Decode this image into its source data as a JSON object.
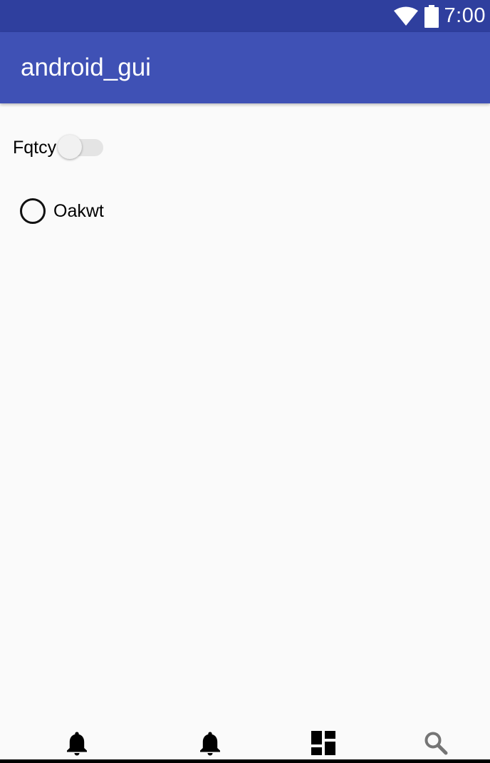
{
  "status_bar": {
    "time": "7:00",
    "icons": [
      "wifi-icon",
      "battery-icon"
    ],
    "background_color": "#2f3f9e"
  },
  "app_bar": {
    "title": "android_gui",
    "background_color": "#3f51b5"
  },
  "content": {
    "switch": {
      "label": "Fqtcy",
      "checked": false
    },
    "radio": {
      "label": "Oakwt",
      "checked": false
    }
  },
  "bottom_nav": {
    "items": [
      {
        "icon": "bell-icon"
      },
      {
        "icon": "bell-icon"
      },
      {
        "icon": "dashboard-icon"
      },
      {
        "icon": "search-icon"
      }
    ]
  }
}
